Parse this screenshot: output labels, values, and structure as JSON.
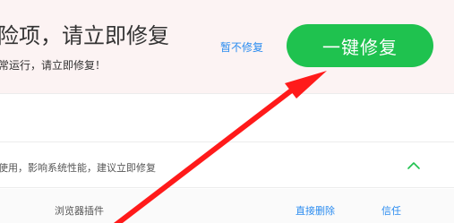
{
  "banner": {
    "title": "险项，请立即修复",
    "subtitle": "常运行，请立即修复！",
    "ignore_label": "暂不修复",
    "fix_button_label": "一键修复"
  },
  "issue": {
    "description": "使用，影响系统性能，建议立即修复",
    "collapse_icon": "chevron-up-icon"
  },
  "detail": {
    "item_label": "浏览器插件",
    "delete_label": "直接删除",
    "trust_label": "信任"
  },
  "colors": {
    "banner_bg": "#fcf3f3",
    "fix_button": "#1fc24f",
    "link": "#2b8cf0",
    "annotation_arrow": "#ff1a1a"
  }
}
